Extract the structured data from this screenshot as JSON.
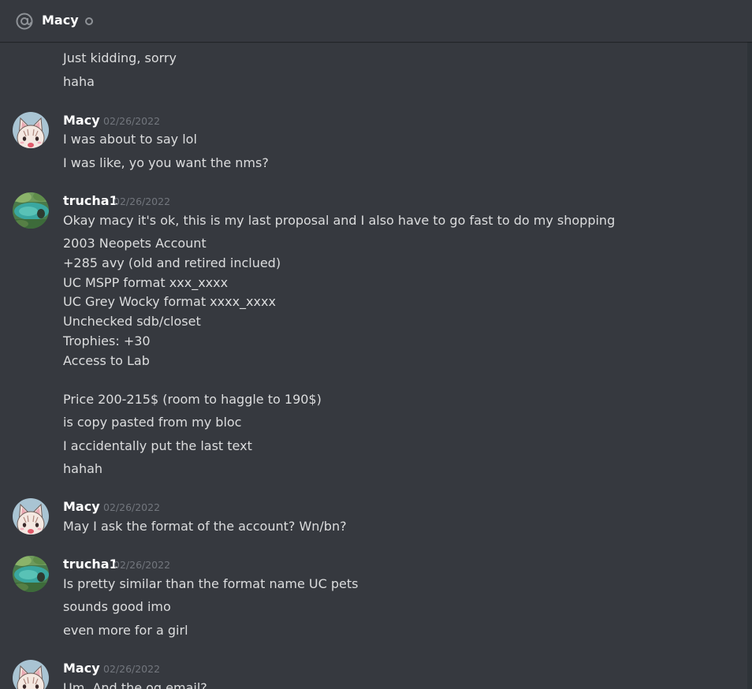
{
  "header": {
    "title": "Macy",
    "icon": "at-sign-icon",
    "status": "offline"
  },
  "messages": [
    {
      "lines": [
        "Just kidding, sorry",
        "haha"
      ]
    },
    {
      "author": "Macy",
      "timestamp": "02/26/2022",
      "avatar": "cat-avatar",
      "lines": [
        "I was about to say lol",
        "I was like, yo you want the nms?"
      ]
    },
    {
      "author": "trucha1",
      "timestamp": "02/26/2022",
      "avatar": "nature-avatar",
      "lines": [
        "Okay macy it's ok, this is my last proposal and I also have to go fast to do my shopping",
        "2003 Neopets Account",
        "+285 avy (old and retired inclued)",
        "UC MSPP format xxx_xxxx",
        "UC Grey Wocky format xxxx_xxxx",
        "Unchecked sdb/closet",
        "Trophies: +30",
        "Access to Lab",
        "Price 200-215$ (room to haggle to 190$)",
        "is copy pasted from my bloc",
        "I accidentally put the last text",
        "hahah"
      ]
    },
    {
      "author": "Macy",
      "timestamp": "02/26/2022",
      "avatar": "cat-avatar",
      "lines": [
        "May I ask the format of the account? Wn/bn?"
      ]
    },
    {
      "author": "trucha1",
      "timestamp": "02/26/2022",
      "avatar": "nature-avatar",
      "lines": [
        "Is pretty similar than the format name UC pets",
        "sounds good imo",
        "even more for a girl"
      ]
    },
    {
      "author": "Macy",
      "timestamp": "02/26/2022",
      "avatar": "cat-avatar",
      "lines": [
        "Um. And the og email?"
      ]
    }
  ],
  "colors": {
    "background": "#36393f",
    "author": "#ffffff",
    "text": "#dcddde",
    "timestamp": "#72767d"
  }
}
